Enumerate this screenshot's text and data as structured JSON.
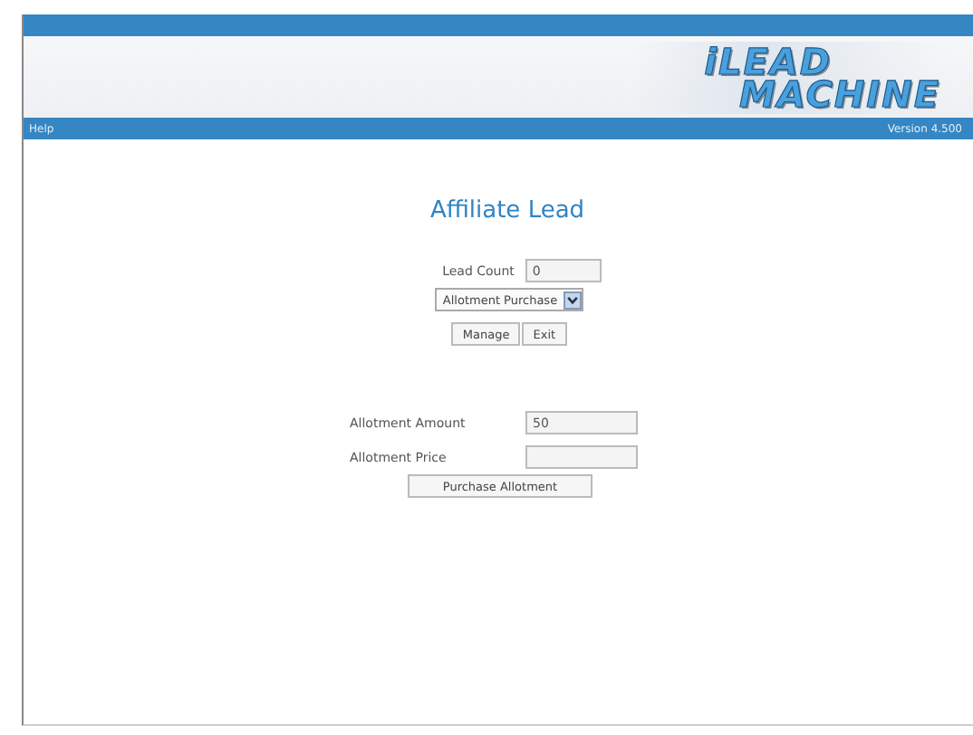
{
  "header": {
    "logo": [
      "iLEAD",
      "MACHINE"
    ]
  },
  "menu_bar": {
    "help": "Help",
    "version": "Version 4.500"
  },
  "title": "Affiliate Lead",
  "lead_count": {
    "label": "Lead Count",
    "value": "0"
  },
  "action_select": {
    "value": "Allotment Purchase"
  },
  "buttons": [
    "Manage",
    "Exit"
  ],
  "allotment_fields": [
    {
      "label": "Allotment Amount",
      "value": "50"
    },
    {
      "label": "Allotment Price"
    }
  ],
  "purchase_button": "Purchase Allotment"
}
